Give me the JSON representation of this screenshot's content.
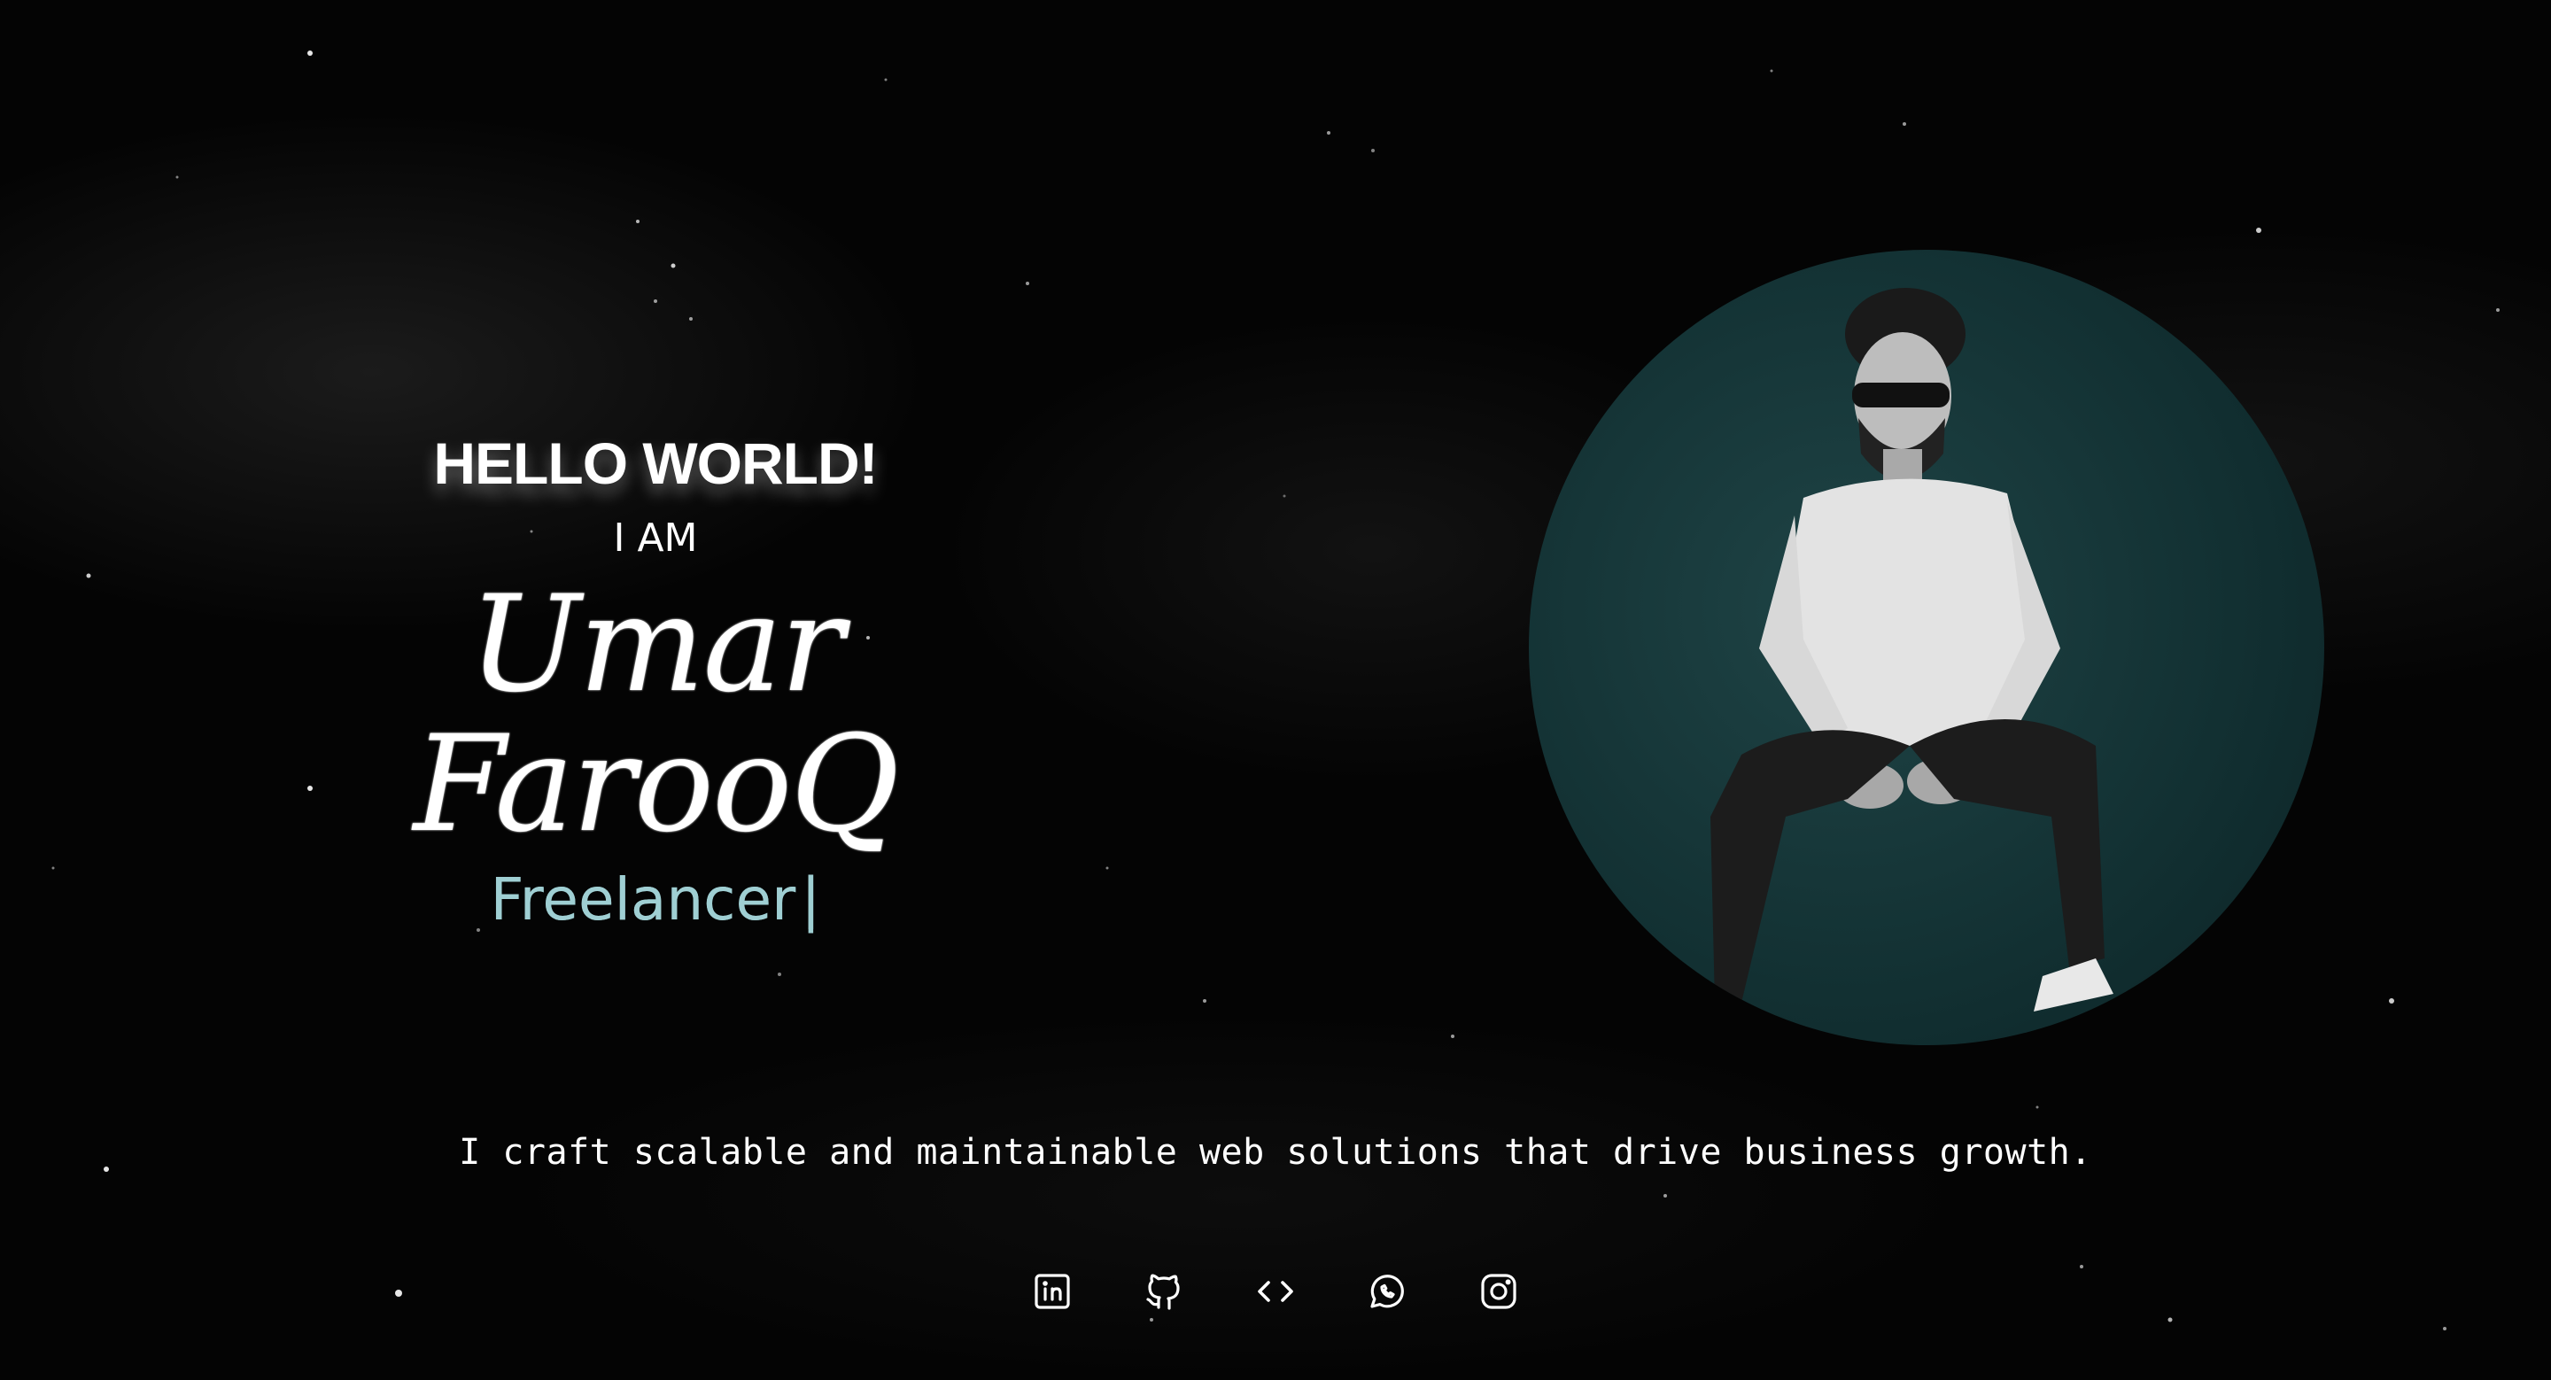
{
  "hero": {
    "greeting": "HELLO WORLD!",
    "intro": "I AM",
    "name": "Umar FarooQ",
    "role": "Freelancer",
    "cursor": "|"
  },
  "tagline": "I craft scalable and maintainable web solutions that drive business growth.",
  "socials": [
    {
      "icon": "linkedin-icon"
    },
    {
      "icon": "github-icon"
    },
    {
      "icon": "code-icon"
    },
    {
      "icon": "whatsapp-icon"
    },
    {
      "icon": "instagram-icon"
    }
  ],
  "colors": {
    "background": "#000000",
    "accent_role": "#9fcfd3",
    "avatar_circle": "#163537",
    "text": "#ffffff"
  }
}
